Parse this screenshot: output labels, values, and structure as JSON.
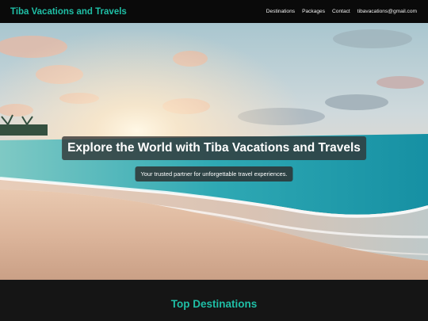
{
  "navbar": {
    "brand": "Tiba Vacations and Travels",
    "links": [
      "Destinations",
      "Packages",
      "Contact",
      "tibavacations@gmail.com"
    ]
  },
  "hero": {
    "title": "Explore the World with Tiba Vacations and Travels",
    "subtitle": "Your trusted partner for unforgettable travel experiences."
  },
  "section": {
    "title": "Top Destinations"
  },
  "colors": {
    "accent": "#1fbfa6",
    "navbar_bg": "#0a0a0a",
    "page_bg": "#151515"
  }
}
